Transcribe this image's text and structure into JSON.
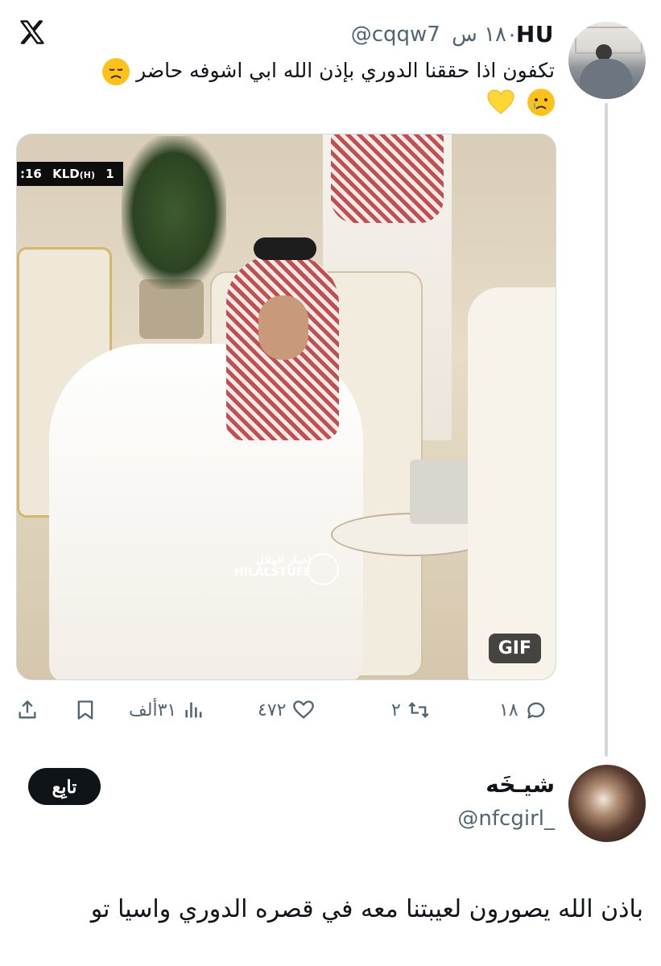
{
  "tweet": {
    "author_name": "HU",
    "author_handle": "@cqqw7",
    "time_ago": "١٨٠ س",
    "text": "تكفون اذا حققنا الدوري بإذن الله ابي اشوفه حاضر",
    "emojis": [
      "disappointed-face",
      "yellow-heart",
      "crying-face"
    ],
    "media": {
      "scorebug": {
        "time": ":16",
        "team": "KLD",
        "tag": "(H)",
        "score": "1"
      },
      "watermark": {
        "arabic": "اخبار الهلال",
        "latin": "HILALSTUFF"
      },
      "badge": "GIF"
    },
    "actions": {
      "replies": "١٨",
      "retweets": "٢",
      "likes": "٤٧٢",
      "views": "٣١ألف"
    }
  },
  "reply": {
    "author_name": "شيـخَه",
    "author_handle": "@nfcgirl_",
    "follow_label": "تابِع",
    "text": "باذن الله يصورون لعيبتنا معه في قصره الدوري واسيا تو"
  },
  "brand": {
    "logo": "x-logo"
  }
}
